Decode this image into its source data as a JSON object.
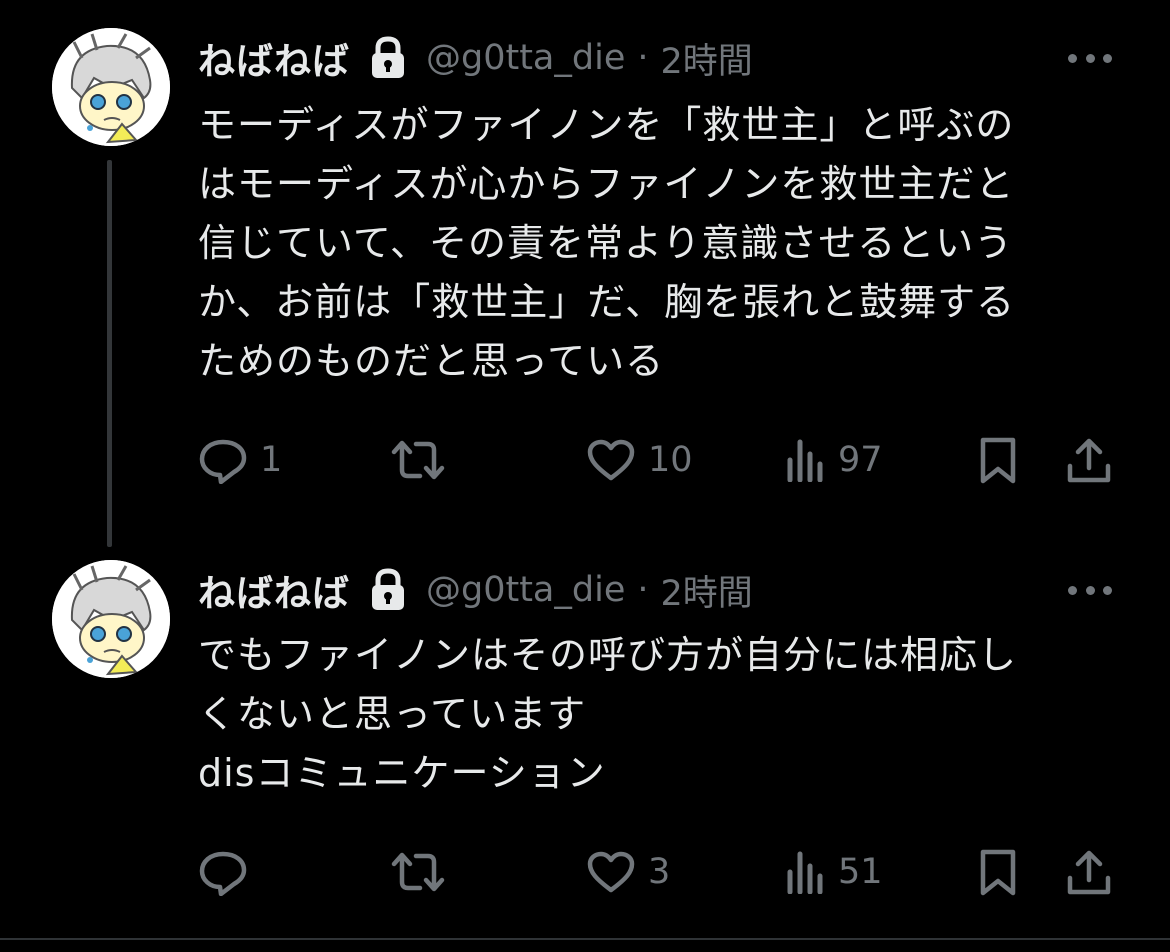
{
  "tweets": [
    {
      "name": "ねばねば",
      "handle": "@g0tta_die",
      "sep": "·",
      "time": "2時間",
      "lines": [
        "モーディスがファイノンを「救世主」と呼ぶの",
        "はモーディスが心からファイノンを救世主だと",
        "信じていて、その責を常より意識させるという",
        "か、お前は「救世主」だ、胸を張れと鼓舞する",
        "ためのものだと思っている"
      ],
      "replies": "1",
      "retweets": "",
      "likes": "10",
      "views": "97"
    },
    {
      "name": "ねばねば",
      "handle": "@g0tta_die",
      "sep": "·",
      "time": "2時間",
      "lines": [
        "でもファイノンはその呼び方が自分には相応し",
        "くないと思っています",
        "disコミュニケーション"
      ],
      "replies": "",
      "retweets": "",
      "likes": "3",
      "views": "51"
    }
  ],
  "colors": {
    "background": "#000000",
    "text": "#e7e9ea",
    "secondary": "#71767b",
    "thread_line": "#333639"
  },
  "icons": [
    "lock-icon",
    "more-icon",
    "reply-icon",
    "retweet-icon",
    "like-icon",
    "views-icon",
    "bookmark-icon",
    "share-icon"
  ]
}
